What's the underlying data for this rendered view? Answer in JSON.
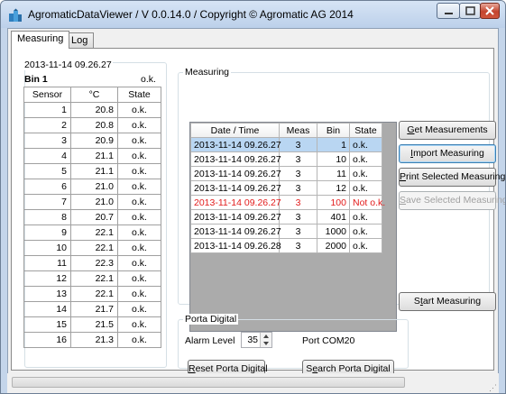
{
  "window": {
    "title": "AgromaticDataViewer / V 0.0.14.0 / Copyright © Agromatic AG 2014"
  },
  "tabs": [
    {
      "label": "Measuring",
      "active": true
    },
    {
      "label": "Log",
      "active": false
    }
  ],
  "left_panel": {
    "timestamp": "2013-11-14 09.26.27",
    "bin_label": "Bin 1",
    "bin_state": "o.k.",
    "headers": [
      "Sensor",
      "°C",
      "State"
    ],
    "rows": [
      [
        "1",
        "20.8",
        "o.k."
      ],
      [
        "2",
        "20.8",
        "o.k."
      ],
      [
        "3",
        "20.9",
        "o.k."
      ],
      [
        "4",
        "21.1",
        "o.k."
      ],
      [
        "5",
        "21.1",
        "o.k."
      ],
      [
        "6",
        "21.0",
        "o.k."
      ],
      [
        "7",
        "21.0",
        "o.k."
      ],
      [
        "8",
        "20.7",
        "o.k."
      ],
      [
        "9",
        "22.1",
        "o.k."
      ],
      [
        "10",
        "22.1",
        "o.k."
      ],
      [
        "11",
        "22.3",
        "o.k."
      ],
      [
        "12",
        "22.1",
        "o.k."
      ],
      [
        "13",
        "22.1",
        "o.k."
      ],
      [
        "14",
        "21.7",
        "o.k."
      ],
      [
        "15",
        "21.5",
        "o.k."
      ],
      [
        "16",
        "21.3",
        "o.k."
      ]
    ]
  },
  "measuring": {
    "group_label": "Measuring",
    "headers": [
      "Date / Time",
      "Meas",
      "Bin",
      "State"
    ],
    "rows": [
      [
        "2013-11-14 09.26.27",
        "3",
        "1",
        "o.k."
      ],
      [
        "2013-11-14 09.26.27",
        "3",
        "10",
        "o.k."
      ],
      [
        "2013-11-14 09.26.27",
        "3",
        "11",
        "o.k."
      ],
      [
        "2013-11-14 09.26.27",
        "3",
        "12",
        "o.k."
      ],
      [
        "2013-11-14 09.26.27",
        "3",
        "100",
        "Not o.k."
      ],
      [
        "2013-11-14 09.26.27",
        "3",
        "401",
        "o.k."
      ],
      [
        "2013-11-14 09.26.27",
        "3",
        "1000",
        "o.k."
      ],
      [
        "2013-11-14 09.26.28",
        "3",
        "2000",
        "o.k."
      ]
    ],
    "selected_row": 0,
    "error_row": 4,
    "error_color": "#e31b1b",
    "selection_color": "#b9d6f2"
  },
  "buttons": {
    "get_measurements": {
      "accel": "G",
      "rest": "et Measurements"
    },
    "import_measuring": {
      "accel": "I",
      "rest": "mport Measuring"
    },
    "print_selected": {
      "accel": "P",
      "rest": "rint Selected Measuring"
    },
    "save_selected": {
      "accel": "S",
      "rest": "ave Selected Measuring"
    },
    "start_measuring": {
      "pre": "S",
      "accel": "t",
      "rest": "art Measuring"
    }
  },
  "porta": {
    "group_label": "Porta Digital",
    "alarm_label": "Alarm Level",
    "alarm_value": "35",
    "port_label": "Port COM20",
    "reset": {
      "accel": "R",
      "rest": "eset Porta Digital"
    },
    "search": {
      "pre": "S",
      "accel": "e",
      "rest": "arch Porta Digital"
    }
  }
}
